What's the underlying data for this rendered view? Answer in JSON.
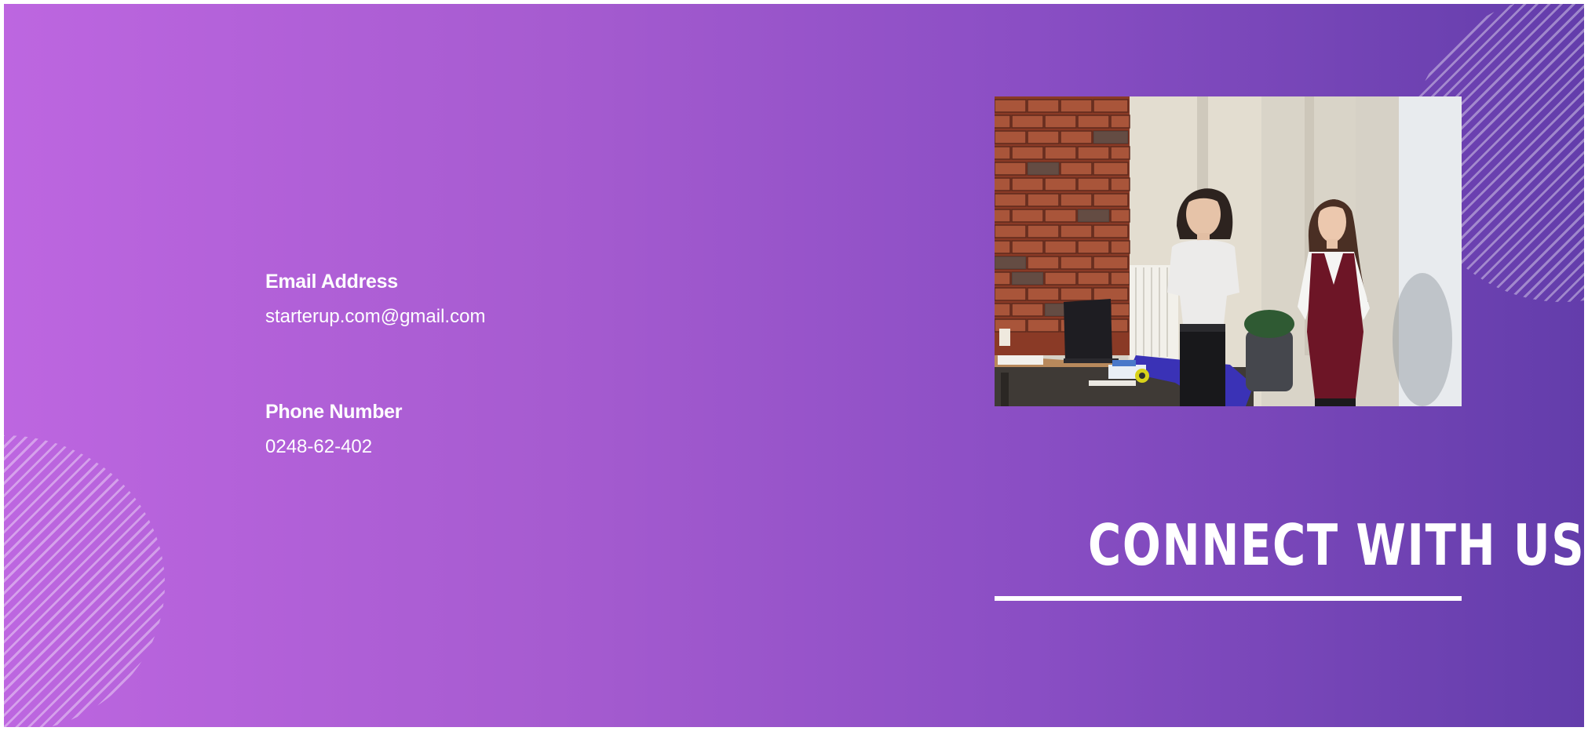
{
  "contact": {
    "email_label": "Email Address",
    "email_value": "starterup.com@gmail.com",
    "phone_label": "Phone Number",
    "phone_value": "0248-62-402"
  },
  "heading": {
    "title": "CONNECT WITH US"
  },
  "colors": {
    "gradient_start": "#bd66e0",
    "gradient_end": "#633dab",
    "text": "#ffffff"
  },
  "photo": {
    "subject": "two young women presenting beside a desk with a small robot car, brick wall background"
  }
}
